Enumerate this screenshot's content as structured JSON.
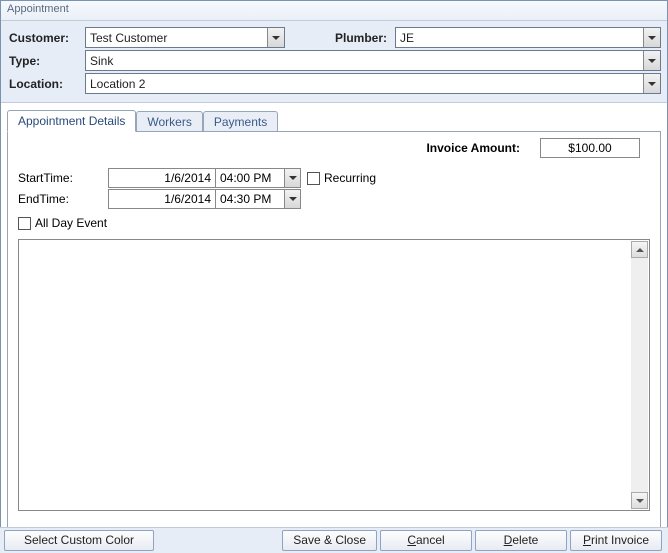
{
  "window": {
    "title": "Appointment"
  },
  "header": {
    "customer_label": "Customer:",
    "customer_value": "Test Customer",
    "plumber_label": "Plumber:",
    "plumber_value": "JE",
    "type_label": "Type:",
    "type_value": "Sink",
    "location_label": "Location:",
    "location_value": "Location 2"
  },
  "tabs": {
    "details": "Appointment Details",
    "workers": "Workers",
    "payments": "Payments"
  },
  "details": {
    "invoice_label": "Invoice Amount:",
    "invoice_value": "$100.00",
    "start_label": "StartTime:",
    "start_date": "1/6/2014",
    "start_time": "04:00 PM",
    "end_label": "EndTime:",
    "end_date": "1/6/2014",
    "end_time": "04:30 PM",
    "recurring_label": "Recurring",
    "allday_label": "All Day Event",
    "notes": ""
  },
  "footer": {
    "color": "Select Custom Color",
    "save": "Save & Close",
    "cancel_pre": "",
    "cancel_u": "C",
    "cancel_post": "ancel",
    "delete_pre": "",
    "delete_u": "D",
    "delete_post": "elete",
    "print_pre": "",
    "print_u": "P",
    "print_post": "rint Invoice"
  }
}
